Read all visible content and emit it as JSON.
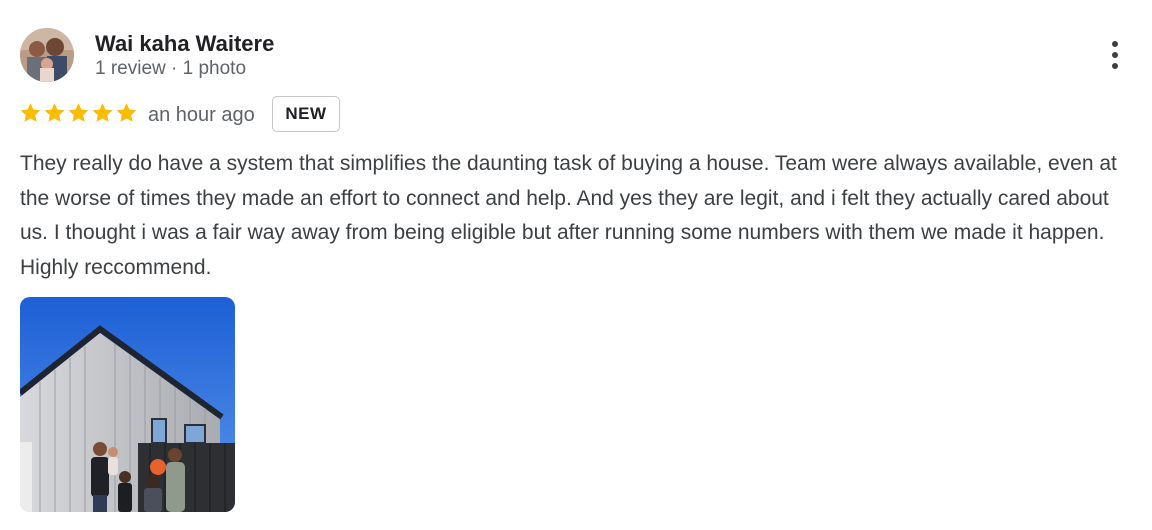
{
  "reviewer": {
    "name": "Wai kaha Waitere",
    "meta": "1 review · 1 photo"
  },
  "review": {
    "rating": 5,
    "max_rating": 5,
    "time_ago": "an hour ago",
    "badge": "NEW",
    "text": "They really do have a system that simplifies the daunting task of buying a house. Team were always available, even at the worse of times they made an effort to connect and help. And yes they are legit, and i felt they actually cared about us. I thought i was a fair way away from being eligible but after running some numbers with them we made it happen. Highly reccommend.",
    "photo_count": 1
  },
  "icons": {
    "more": "more-vert-icon",
    "star": "star-icon"
  },
  "colors": {
    "star": "#fbbc04",
    "name": "#202124",
    "secondary_text": "#5f6368",
    "body_text": "#3c4043",
    "badge_border": "#c4c7c5"
  }
}
